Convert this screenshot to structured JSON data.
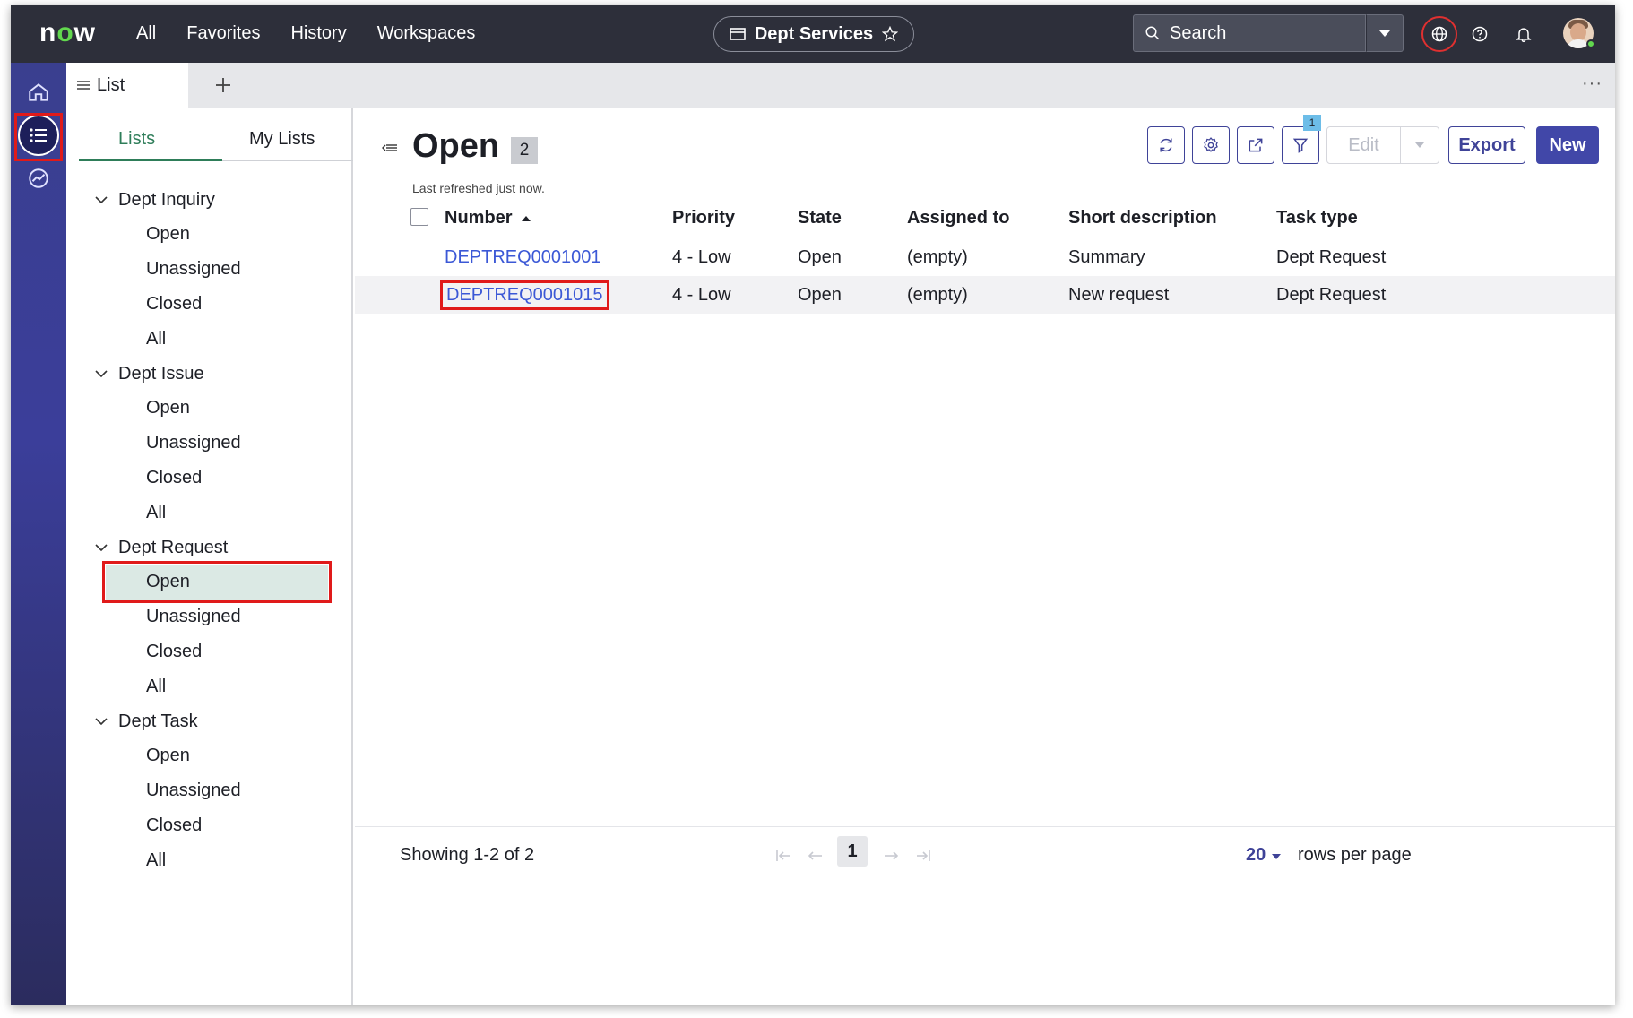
{
  "topbar": {
    "logo": "now",
    "nav": [
      "All",
      "Favorites",
      "History",
      "Workspaces"
    ],
    "workspace": "Dept Services",
    "search_placeholder": "Search"
  },
  "tabs": {
    "active_tab": "List"
  },
  "panel": {
    "tab_lists": "Lists",
    "tab_my_lists": "My Lists",
    "groups": [
      {
        "title": "Dept Inquiry",
        "items": [
          "Open",
          "Unassigned",
          "Closed",
          "All"
        ]
      },
      {
        "title": "Dept Issue",
        "items": [
          "Open",
          "Unassigned",
          "Closed",
          "All"
        ]
      },
      {
        "title": "Dept Request",
        "items": [
          "Open",
          "Unassigned",
          "Closed",
          "All"
        ]
      },
      {
        "title": "Dept Task",
        "items": [
          "Open",
          "Unassigned",
          "Closed",
          "All"
        ]
      }
    ],
    "selected": "Dept Request / Open"
  },
  "main": {
    "title": "Open",
    "count": "2",
    "refreshed": "Last refreshed just now.",
    "filter_count": "1",
    "edit_label": "Edit",
    "export_label": "Export",
    "new_label": "New",
    "columns": [
      "Number",
      "Priority",
      "State",
      "Assigned to",
      "Short description",
      "Task type"
    ],
    "rows": [
      [
        "DEPTREQ0001001",
        "4 - Low",
        "Open",
        "(empty)",
        "Summary",
        "Dept Request"
      ],
      [
        "DEPTREQ0001015",
        "4 - Low",
        "Open",
        "(empty)",
        "New request",
        "Dept Request"
      ]
    ],
    "showing": "Showing 1-2 of 2",
    "page": "1",
    "rows_per_page": "20",
    "rows_per_page_label": "rows per page"
  },
  "colors": {
    "topbar": "#2d2f3a",
    "accent": "#4147a8",
    "link": "#3b58d6",
    "highlight": "#e01a1a",
    "selected_bg": "#dbe9e4",
    "tab_green": "#2e7d59"
  }
}
